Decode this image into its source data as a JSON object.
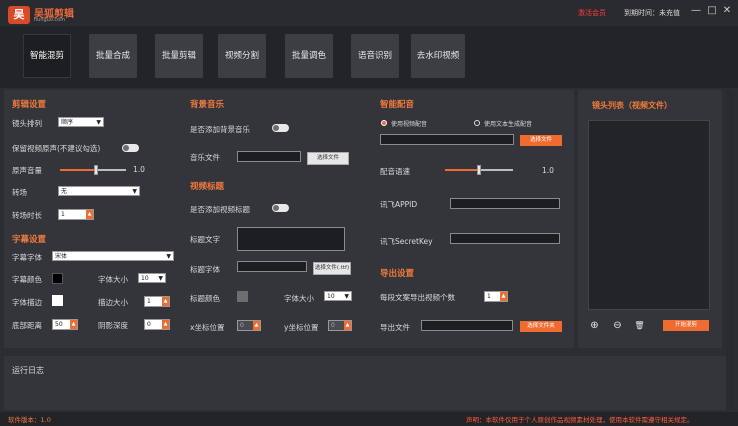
{
  "titlebar": {
    "logo_glyph": "吴",
    "app_name": "吴狐剪辑",
    "app_sub": "hunguo.com",
    "red_text": "激活会员",
    "user_text": "到期时间：未充值",
    "min": "—",
    "max": "□",
    "close": "✕"
  },
  "nav": [
    {
      "label": "智能混剪",
      "active": true
    },
    {
      "label": "批量合成"
    },
    {
      "label": "批量剪辑"
    },
    {
      "label": "视频分割"
    },
    {
      "label": "批量调色"
    },
    {
      "label": "语音识别"
    },
    {
      "label": "去水印视频"
    }
  ],
  "cut": {
    "title": "剪辑设置",
    "shot_order_label": "镜头排列",
    "shot_order_value": "顺序",
    "keep_audio_label": "保留视频原声(不建议勾选)",
    "orig_vol_label": "原声音量",
    "orig_vol_value": "1.0",
    "orig_vol": 0.55,
    "trans_label": "转场",
    "trans_value": "无",
    "trans_dur_label": "转场时长",
    "trans_dur_value": "1"
  },
  "subtitle": {
    "title": "字幕设置",
    "font_label": "字幕字体",
    "font_value": "宋体",
    "color_label": "字幕颜色",
    "size_label": "字体大小",
    "size_value": "10",
    "stroke_label": "字体描边",
    "stroke_size_label": "描边大小",
    "stroke_size_value": "1",
    "bottom_label": "底部距离",
    "bottom_value": "50",
    "shadow_label": "阴影深度",
    "shadow_value": "0"
  },
  "music": {
    "title": "背景音乐",
    "add_label": "是否添加背景音乐",
    "file_label": "音乐文件",
    "file_btn": "选择文件"
  },
  "vtitle": {
    "title": "视频标题",
    "add_label": "是否添加视频标题",
    "text_label": "标题文字",
    "font_label": "标题字体",
    "font_btn": "选择文件(.ttf)",
    "color_label": "标题颜色",
    "size_label": "字体大小",
    "size_value": "10",
    "x_label": "x坐标位置",
    "x_value": "0",
    "y_label": "y坐标位置",
    "y_value": "0"
  },
  "voice": {
    "title": "智能配音",
    "opt1": "使用视频配音",
    "opt2": "使用文本生成配音",
    "file_btn": "选择文件",
    "speed_label": "配音语速",
    "speed_value": "1.0",
    "speed": 0.5,
    "appid_label": "讯飞APPID",
    "secret_label": "讯飞SecretKey"
  },
  "export": {
    "title": "导出设置",
    "count_label": "每段文案导出视频个数",
    "count_value": "1",
    "file_label": "导出文件",
    "file_btn": "选择文件夹"
  },
  "right": {
    "title": "镜头列表（视频文件）",
    "add": "⊕",
    "remove": "⊖",
    "delete": "🗑",
    "start_btn": "开始混剪"
  },
  "log": {
    "title": "运行日志"
  },
  "status": {
    "version": "软件版本：1.0",
    "note": "声明：本软件仅用于个人原创作品视频素材处理，使用本软件需遵守相关规定。"
  }
}
